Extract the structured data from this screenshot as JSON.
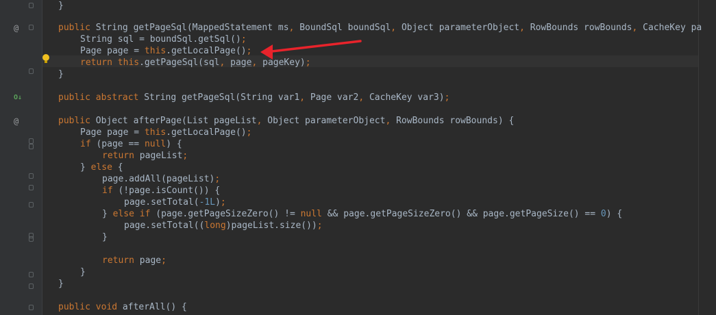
{
  "editor": {
    "lines": [
      {
        "indent": 1,
        "tokens": [
          {
            "t": "}",
            "c": "p"
          }
        ]
      },
      {
        "indent": 1,
        "tokens": [
          {
            "t": "public ",
            "c": "kw"
          },
          {
            "t": "String getPageSql(MappedStatement ms",
            "c": "p"
          },
          {
            "t": ", ",
            "c": "kw"
          },
          {
            "t": "BoundSql boundSql",
            "c": "p"
          },
          {
            "t": ", ",
            "c": "kw"
          },
          {
            "t": "Object parameterObject",
            "c": "p"
          },
          {
            "t": ", ",
            "c": "kw"
          },
          {
            "t": "RowBounds rowBounds",
            "c": "p"
          },
          {
            "t": ", ",
            "c": "kw"
          },
          {
            "t": "CacheKey pa",
            "c": "p"
          }
        ]
      },
      {
        "indent": 2,
        "tokens": [
          {
            "t": "String sql = boundSql.getSql()",
            "c": "p"
          },
          {
            "t": ";",
            "c": "kw"
          }
        ]
      },
      {
        "indent": 2,
        "tokens": [
          {
            "t": "Page page = ",
            "c": "p"
          },
          {
            "t": "this",
            "c": "kw"
          },
          {
            "t": ".getLocalPage()",
            "c": "p"
          },
          {
            "t": ";",
            "c": "kw"
          }
        ]
      },
      {
        "indent": 2,
        "tokens": [
          {
            "t": "return this",
            "c": "kw"
          },
          {
            "t": ".getPageSql(sql",
            "c": "p"
          },
          {
            "t": ", ",
            "c": "kw"
          },
          {
            "t": "page",
            "c": "u"
          },
          {
            "t": ", ",
            "c": "kw"
          },
          {
            "t": "pageKey)",
            "c": "p"
          },
          {
            "t": ";",
            "c": "kw"
          }
        ]
      },
      {
        "indent": 1,
        "tokens": [
          {
            "t": "}",
            "c": "p"
          }
        ]
      },
      {
        "indent": 1,
        "tokens": []
      },
      {
        "indent": 1,
        "tokens": [
          {
            "t": "public abstract ",
            "c": "kw"
          },
          {
            "t": "String getPageSql(String var1",
            "c": "p"
          },
          {
            "t": ", ",
            "c": "kw"
          },
          {
            "t": "Page var2",
            "c": "p"
          },
          {
            "t": ", ",
            "c": "kw"
          },
          {
            "t": "CacheKey var3)",
            "c": "p"
          },
          {
            "t": ";",
            "c": "kw"
          }
        ]
      },
      {
        "indent": 1,
        "tokens": []
      },
      {
        "indent": 1,
        "tokens": [
          {
            "t": "public ",
            "c": "kw"
          },
          {
            "t": "Object afterPage(List pageList",
            "c": "p"
          },
          {
            "t": ", ",
            "c": "kw"
          },
          {
            "t": "Object parameterObject",
            "c": "p"
          },
          {
            "t": ", ",
            "c": "kw"
          },
          {
            "t": "RowBounds rowBounds) {",
            "c": "p"
          }
        ]
      },
      {
        "indent": 2,
        "tokens": [
          {
            "t": "Page page = ",
            "c": "p"
          },
          {
            "t": "this",
            "c": "kw"
          },
          {
            "t": ".getLocalPage()",
            "c": "p"
          },
          {
            "t": ";",
            "c": "kw"
          }
        ]
      },
      {
        "indent": 2,
        "tokens": [
          {
            "t": "if ",
            "c": "kw"
          },
          {
            "t": "(page == ",
            "c": "p"
          },
          {
            "t": "null",
            "c": "kw"
          },
          {
            "t": ") {",
            "c": "p"
          }
        ]
      },
      {
        "indent": 3,
        "tokens": [
          {
            "t": "return ",
            "c": "kw"
          },
          {
            "t": "pageList",
            "c": "p"
          },
          {
            "t": ";",
            "c": "kw"
          }
        ]
      },
      {
        "indent": 2,
        "tokens": [
          {
            "t": "} ",
            "c": "p"
          },
          {
            "t": "else ",
            "c": "kw"
          },
          {
            "t": "{",
            "c": "p"
          }
        ]
      },
      {
        "indent": 3,
        "tokens": [
          {
            "t": "page.addAll(pageList)",
            "c": "p"
          },
          {
            "t": ";",
            "c": "kw"
          }
        ]
      },
      {
        "indent": 3,
        "tokens": [
          {
            "t": "if ",
            "c": "kw"
          },
          {
            "t": "(!page.isCount()) {",
            "c": "p"
          }
        ]
      },
      {
        "indent": 4,
        "tokens": [
          {
            "t": "page.setTotal(",
            "c": "p"
          },
          {
            "t": "-1L",
            "c": "num"
          },
          {
            "t": ")",
            "c": "p"
          },
          {
            "t": ";",
            "c": "kw"
          }
        ]
      },
      {
        "indent": 3,
        "tokens": [
          {
            "t": "} ",
            "c": "p"
          },
          {
            "t": "else if ",
            "c": "kw"
          },
          {
            "t": "(page.getPageSizeZero() != ",
            "c": "p"
          },
          {
            "t": "null ",
            "c": "kw"
          },
          {
            "t": "&& page.getPageSizeZero() && page.getPageSize() == ",
            "c": "p"
          },
          {
            "t": "0",
            "c": "num"
          },
          {
            "t": ") {",
            "c": "p"
          }
        ]
      },
      {
        "indent": 4,
        "tokens": [
          {
            "t": "page.setTotal((",
            "c": "p"
          },
          {
            "t": "long",
            "c": "kw"
          },
          {
            "t": ")pageList.size())",
            "c": "p"
          },
          {
            "t": ";",
            "c": "kw"
          }
        ]
      },
      {
        "indent": 3,
        "tokens": [
          {
            "t": "}",
            "c": "p"
          }
        ]
      },
      {
        "indent": 3,
        "tokens": []
      },
      {
        "indent": 3,
        "tokens": [
          {
            "t": "return ",
            "c": "kw"
          },
          {
            "t": "page",
            "c": "p"
          },
          {
            "t": ";",
            "c": "kw"
          }
        ]
      },
      {
        "indent": 2,
        "tokens": [
          {
            "t": "}",
            "c": "p"
          }
        ]
      },
      {
        "indent": 1,
        "tokens": [
          {
            "t": "}",
            "c": "p"
          }
        ]
      },
      {
        "indent": 1,
        "tokens": []
      },
      {
        "indent": 1,
        "tokens": [
          {
            "t": "public void ",
            "c": "kw"
          },
          {
            "t": "afterAll() {",
            "c": "p"
          }
        ]
      }
    ],
    "gutter_icons": [
      {
        "line": 1,
        "glyph": "@",
        "name": "override-annotation-icon",
        "kind": "at"
      },
      {
        "line": 7,
        "glyph": "O↓",
        "name": "implemented-method-icon",
        "kind": "impl"
      },
      {
        "line": 9,
        "glyph": "@",
        "name": "override-annotation-icon",
        "kind": "at"
      }
    ],
    "colors": {
      "background": "#2b2b2b",
      "gutter": "#313335",
      "keyword": "#cc7832",
      "plain": "#a9b7c6",
      "number": "#6897bb",
      "annotation_arrow": "#e8232b",
      "bulb": "#f0c020"
    }
  }
}
